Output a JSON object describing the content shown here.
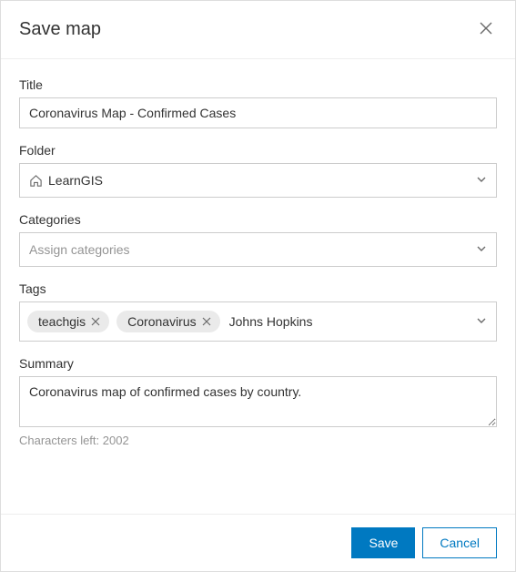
{
  "dialog": {
    "title": "Save map"
  },
  "fields": {
    "title": {
      "label": "Title",
      "value": "Coronavirus Map - Confirmed Cases"
    },
    "folder": {
      "label": "Folder",
      "value": "LearnGIS"
    },
    "categories": {
      "label": "Categories",
      "placeholder": "Assign categories"
    },
    "tags": {
      "label": "Tags",
      "items": [
        {
          "label": "teachgis"
        },
        {
          "label": "Coronavirus"
        }
      ],
      "pending": "Johns Hopkins"
    },
    "summary": {
      "label": "Summary",
      "value": "Coronavirus map of confirmed cases by country.",
      "chars_left_text": "Characters left: 2002"
    }
  },
  "buttons": {
    "save": "Save",
    "cancel": "Cancel"
  }
}
